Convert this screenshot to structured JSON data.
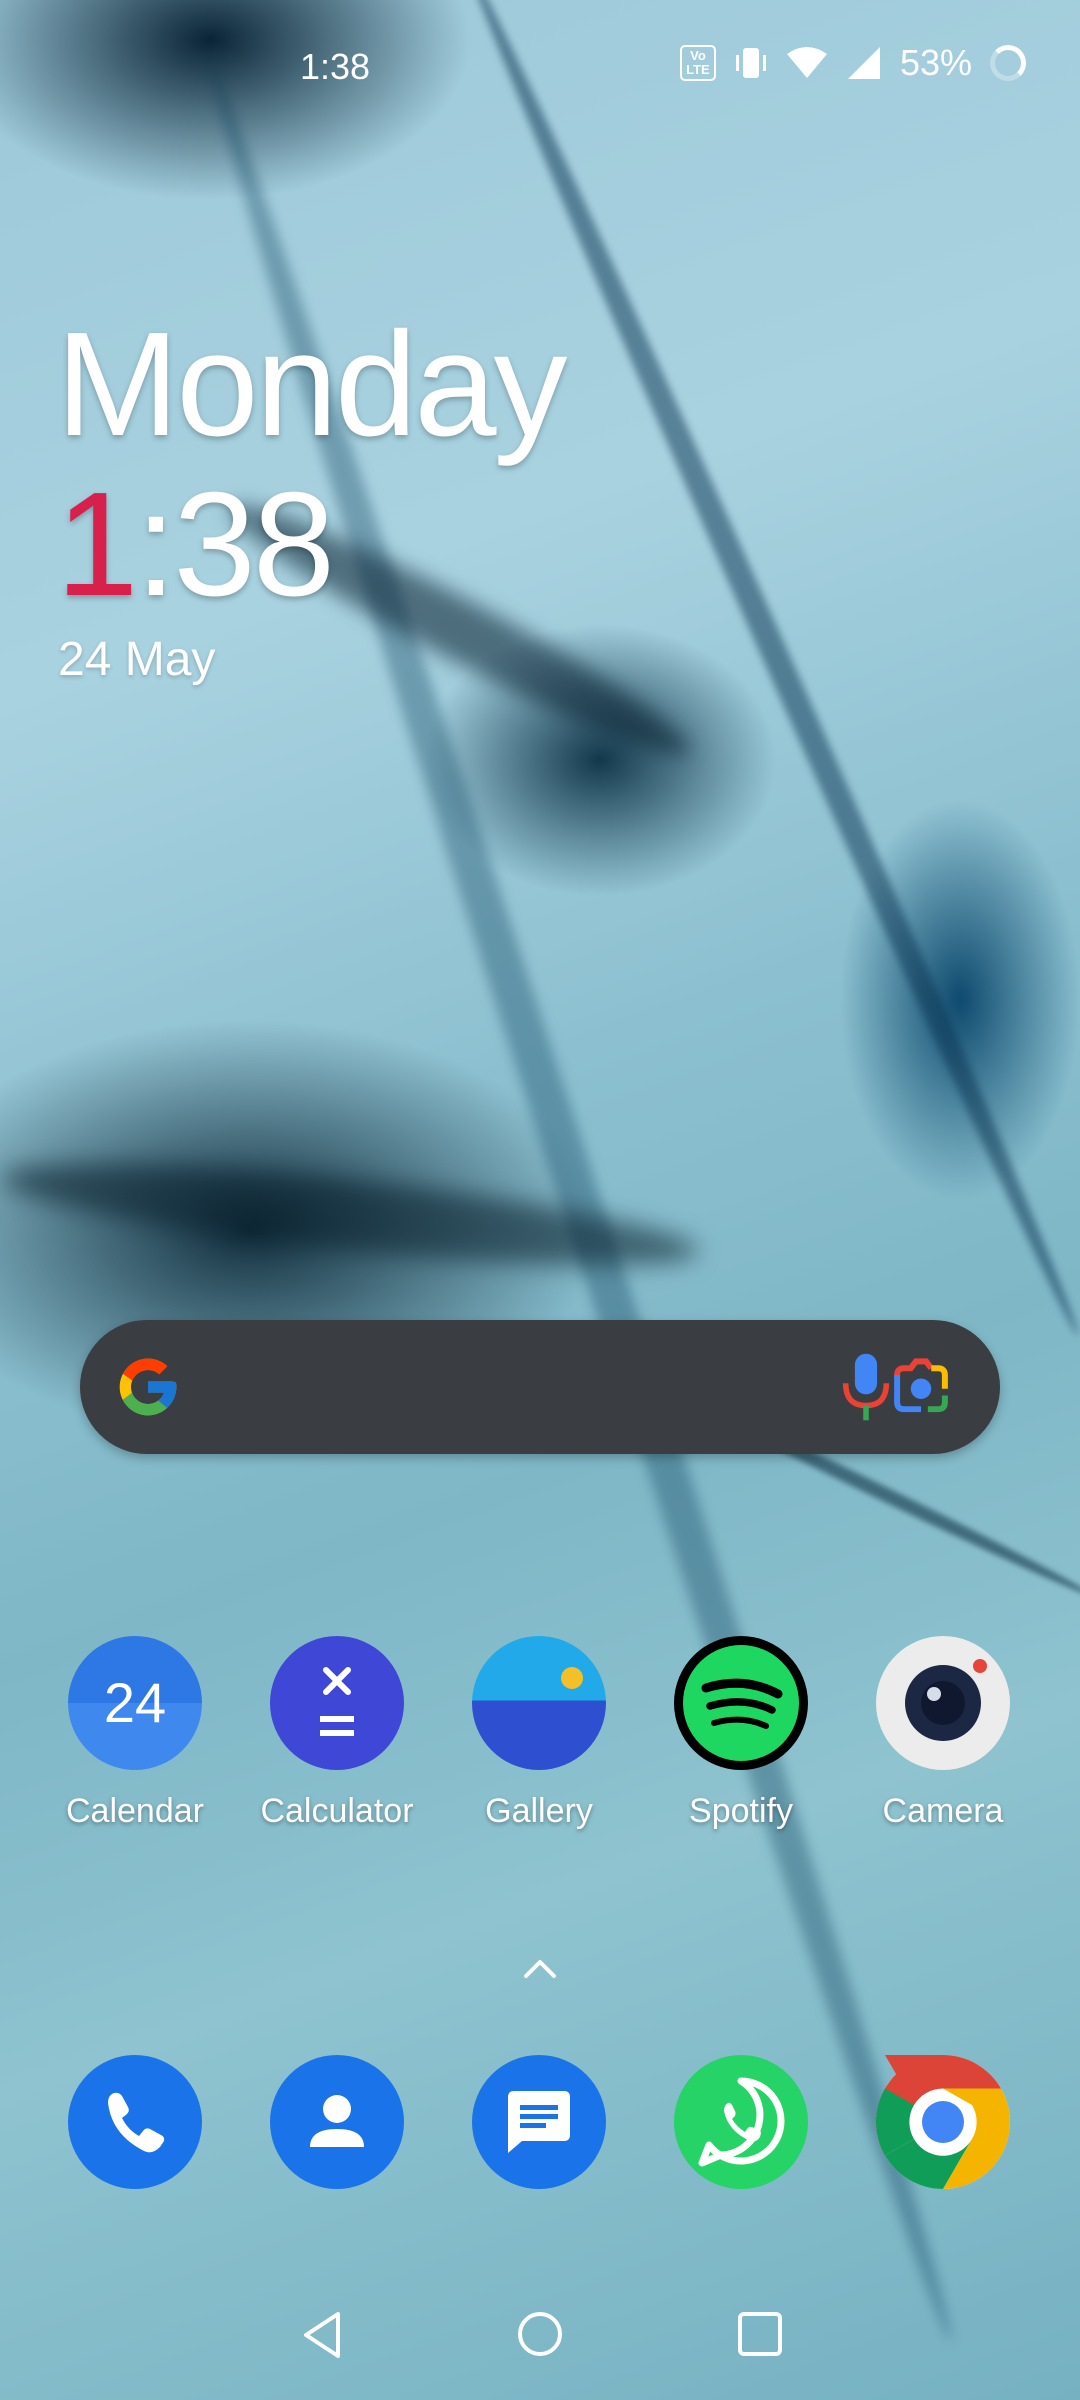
{
  "status_bar": {
    "time": "1:38",
    "lte_badge": "Vo LTE",
    "battery": "53%"
  },
  "clock_widget": {
    "day": "Monday",
    "time_first_digit": "1",
    "time_rest": ":38",
    "date": "24 May"
  },
  "search_bar": {
    "icons": [
      "google-logo",
      "mic-icon",
      "lens-icon"
    ]
  },
  "apps": [
    {
      "label": "Calendar",
      "icon": "calendar-icon",
      "icon_text": "24"
    },
    {
      "label": "Calculator",
      "icon": "calculator-icon"
    },
    {
      "label": "Gallery",
      "icon": "gallery-icon"
    },
    {
      "label": "Spotify",
      "icon": "spotify-icon"
    },
    {
      "label": "Camera",
      "icon": "camera-icon"
    }
  ],
  "dock": [
    "phone-icon",
    "contacts-icon",
    "messages-icon",
    "whatsapp-icon",
    "chrome-icon"
  ],
  "navigation": [
    "back",
    "home",
    "recents"
  ],
  "colors": {
    "clock_accent": "#d8204c",
    "search_bg": "#3a3d41"
  }
}
